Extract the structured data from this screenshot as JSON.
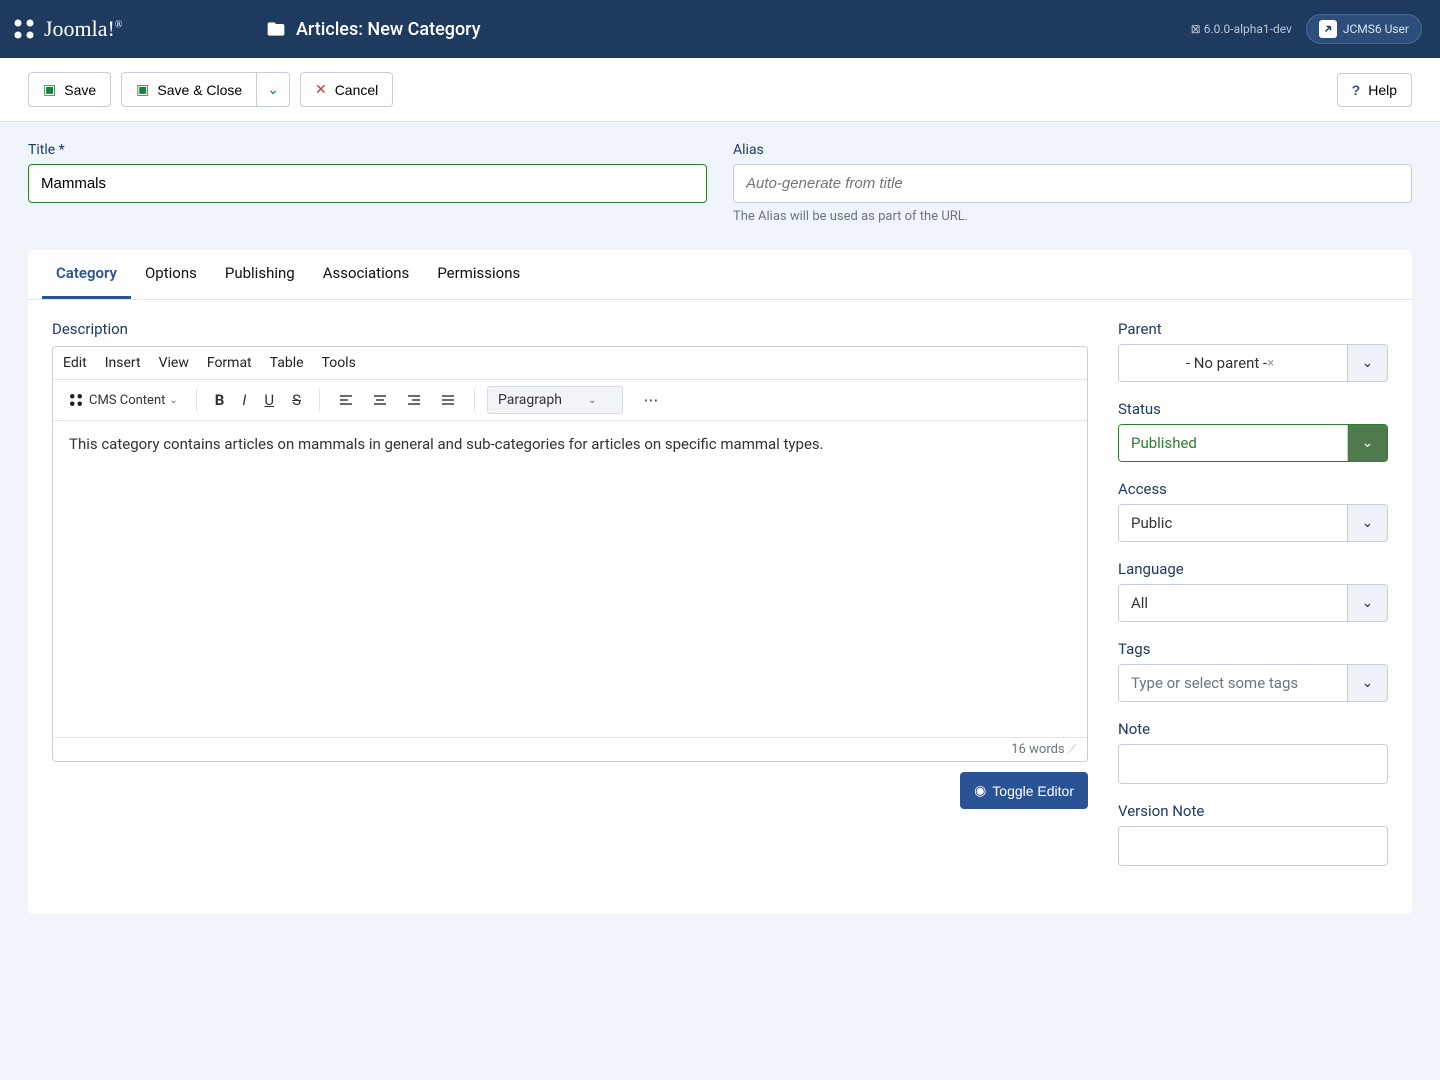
{
  "header": {
    "brand": "Joomla!",
    "page_title": "Articles: New Category",
    "version": "6.0.0-alpha1-dev",
    "user": "JCMS6 User"
  },
  "toolbar": {
    "save": "Save",
    "save_close": "Save & Close",
    "cancel": "Cancel",
    "help": "Help"
  },
  "form": {
    "title_label": "Title *",
    "title_value": "Mammals",
    "alias_label": "Alias",
    "alias_placeholder": "Auto-generate from title",
    "alias_hint": "The Alias will be used as part of the URL."
  },
  "tabs": [
    "Category",
    "Options",
    "Publishing",
    "Associations",
    "Permissions"
  ],
  "editor": {
    "description_label": "Description",
    "menu": [
      "Edit",
      "Insert",
      "View",
      "Format",
      "Table",
      "Tools"
    ],
    "cms_content": "CMS Content",
    "block_format": "Paragraph",
    "body": "This category contains articles on mammals in general and sub-categories for articles on specific mammal types.",
    "word_count": "16 words",
    "toggle": "Toggle Editor"
  },
  "side": {
    "parent_label": "Parent",
    "parent_value": "- No parent -",
    "status_label": "Status",
    "status_value": "Published",
    "access_label": "Access",
    "access_value": "Public",
    "language_label": "Language",
    "language_value": "All",
    "tags_label": "Tags",
    "tags_placeholder": "Type or select some tags",
    "note_label": "Note",
    "version_note_label": "Version Note"
  }
}
